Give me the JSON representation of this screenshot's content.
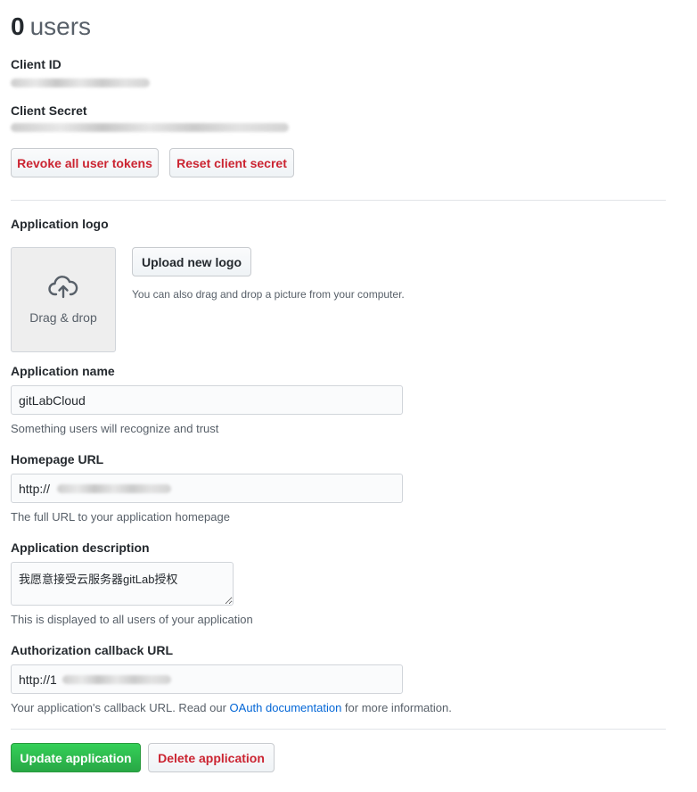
{
  "header": {
    "count": "0",
    "count_label": "users"
  },
  "client": {
    "id_label": "Client ID",
    "secret_label": "Client Secret",
    "revoke_label": "Revoke all user tokens",
    "reset_label": "Reset client secret"
  },
  "logo": {
    "label": "Application logo",
    "drop_text": "Drag & drop",
    "upload_label": "Upload new logo",
    "upload_note": "You can also drag and drop a picture from your computer."
  },
  "form": {
    "name_label": "Application name",
    "name_value": "gitLabCloud",
    "name_help": "Something users will recognize and trust",
    "homepage_label": "Homepage URL",
    "homepage_value": "http://",
    "homepage_help": "The full URL to your application homepage",
    "description_label": "Application description",
    "description_value": "我愿意接受云服务器gitLab授权",
    "description_help": "This is displayed to all users of your application",
    "callback_label": "Authorization callback URL",
    "callback_value": "http://1",
    "callback_help_prefix": "Your application's callback URL. Read our",
    "callback_help_link": "OAuth documentation",
    "callback_help_suffix": "for more information."
  },
  "actions": {
    "update_label": "Update application",
    "delete_label": "Delete application"
  },
  "icons": {
    "upload": "cloud-upload-icon"
  },
  "colors": {
    "danger": "#cb2431",
    "primary": "#28a745",
    "link": "#0366d6"
  }
}
